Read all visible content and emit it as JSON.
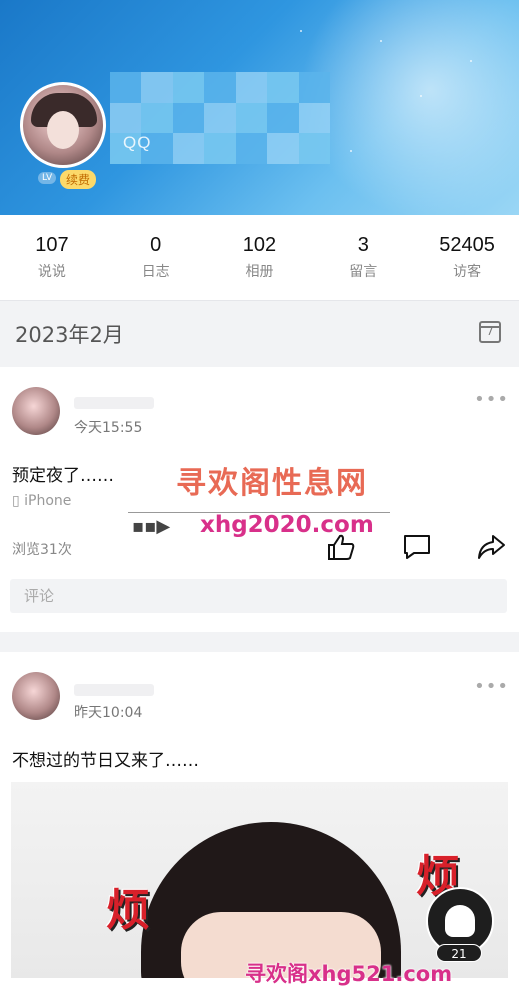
{
  "profile": {
    "qq_label": "QQ",
    "level_badge": "LV",
    "renew_badge": "续费"
  },
  "stats": [
    {
      "value": "107",
      "label": "说说"
    },
    {
      "value": "0",
      "label": "日志"
    },
    {
      "value": "102",
      "label": "相册"
    },
    {
      "value": "3",
      "label": "留言"
    },
    {
      "value": "52405",
      "label": "访客"
    }
  ],
  "month_header": {
    "month": "2023年2月",
    "calendar_day": "7"
  },
  "posts": [
    {
      "time": "今天15:55",
      "text": "预定夜了……",
      "device": "iPhone",
      "views": "浏览31次",
      "comment_placeholder": "评论"
    },
    {
      "time": "昨天10:04",
      "text": "不想过的节日又来了……",
      "image_overlay_text": [
        "烦",
        "烦"
      ]
    }
  ],
  "watermark": {
    "title": "寻欢阁性息网",
    "url": "xhg2020.com",
    "bottom": "寻欢阁xhg521.com"
  },
  "float_button": {
    "count": "21"
  },
  "icons": {
    "more": "more-dots-icon",
    "like": "thumb-up-icon",
    "comment": "comment-bubble-icon",
    "share": "share-arrow-icon",
    "calendar": "calendar-icon",
    "device": "phone-icon"
  }
}
